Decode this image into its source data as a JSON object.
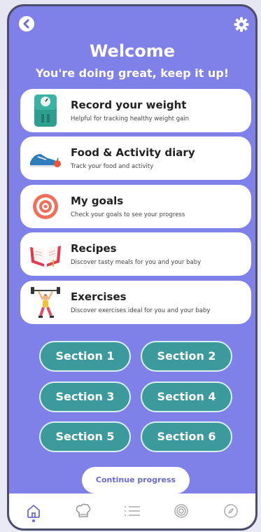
{
  "header": {
    "title": "Welcome",
    "subtitle": "You're doing great, keep it up!"
  },
  "cards": [
    {
      "title": "Record your weight",
      "desc": "Helpful for tracking healthy weight gain",
      "icon": "scale-icon"
    },
    {
      "title": "Food & Activity diary",
      "desc": "Track your food and activity",
      "icon": "sneaker-icon"
    },
    {
      "title": "My goals",
      "desc": "Check your goals to see your progress",
      "icon": "target-icon"
    },
    {
      "title": "Recipes",
      "desc": "Discover tasty meals for you and your baby",
      "icon": "recipe-book-icon"
    },
    {
      "title": "Exercises",
      "desc": "Discover exercises ideal for you and your baby",
      "icon": "weightlifter-icon"
    }
  ],
  "sections": [
    "Section 1",
    "Section 2",
    "Section 3",
    "Section 4",
    "Section 5",
    "Section 6"
  ],
  "continue_label": "Continue progress",
  "nav": [
    "home-icon",
    "chef-hat-icon",
    "list-icon",
    "target-icon",
    "compass-icon"
  ],
  "colors": {
    "background": "#7f80e8",
    "section": "#3d9a9c",
    "accent": "#6868d0"
  }
}
